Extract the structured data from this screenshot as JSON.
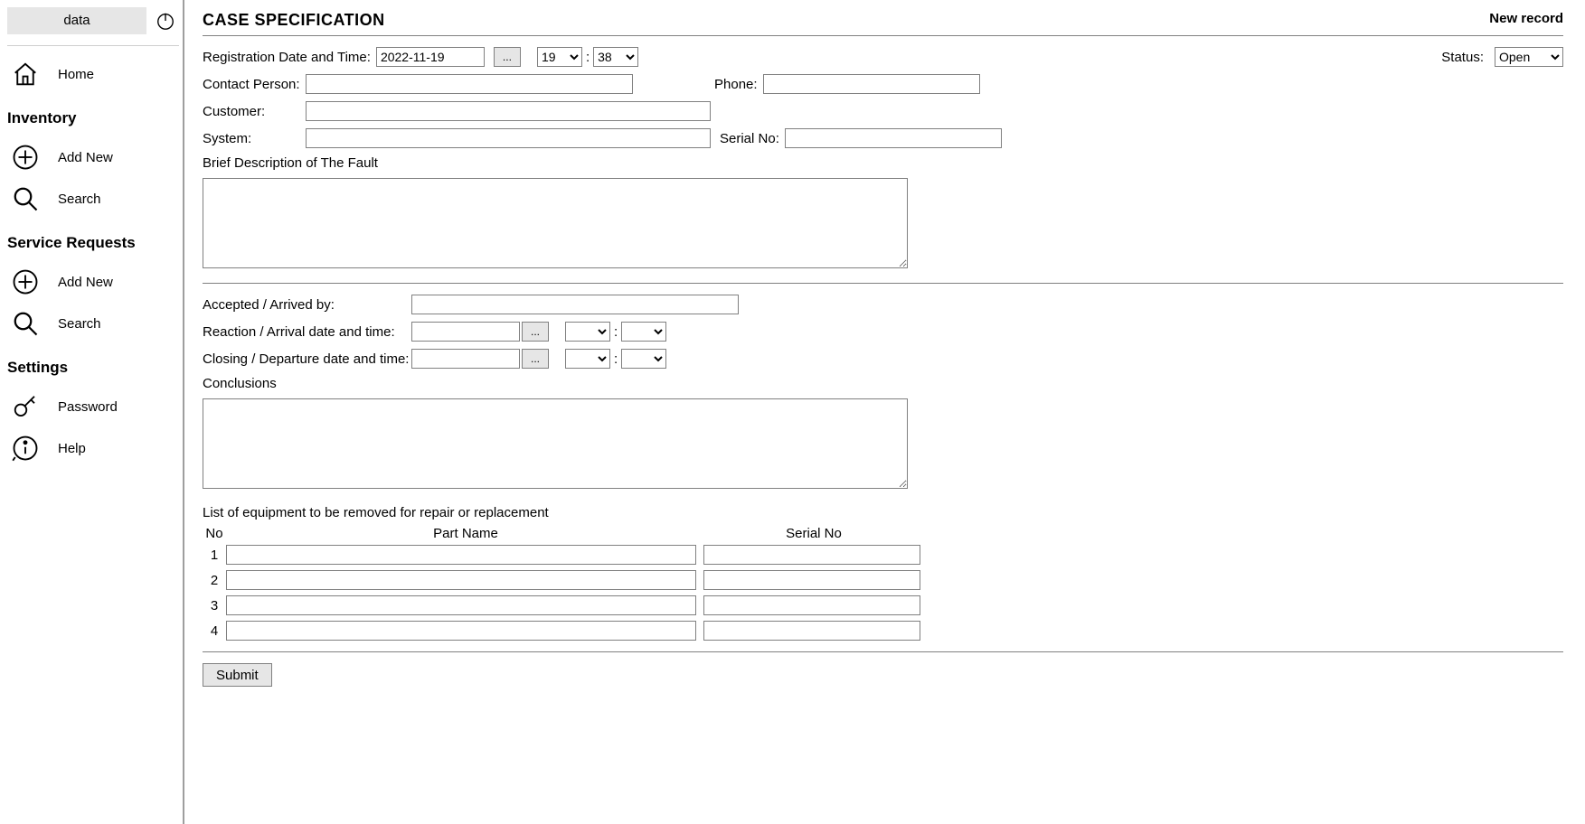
{
  "sidebar": {
    "data_button": "data",
    "home": "Home",
    "sections": {
      "inventory": {
        "title": "Inventory",
        "add": "Add New",
        "search": "Search"
      },
      "service": {
        "title": "Service Requests",
        "add": "Add New",
        "search": "Search"
      },
      "settings": {
        "title": "Settings",
        "password": "Password",
        "help": "Help"
      }
    }
  },
  "header": {
    "title": "CASE SPECIFICATION",
    "new_record": "New record"
  },
  "labels": {
    "reg_datetime": "Registration Date and Time:",
    "status": "Status:",
    "contact": "Contact Person:",
    "phone": "Phone:",
    "customer": "Customer:",
    "system": "System:",
    "serial": "Serial No:",
    "brief": "Brief Description of The Fault",
    "accepted": "Accepted / Arrived by:",
    "reaction": "Reaction / Arrival date and time:",
    "closing": "Closing / Departure date and time:",
    "conclusions": "Conclusions",
    "equip_list": "List of equipment to be removed for repair or replacement",
    "col_no": "No",
    "col_part": "Part Name",
    "col_serial": "Serial No",
    "submit": "Submit",
    "ellipsis": "..."
  },
  "values": {
    "reg_date": "2022-11-19",
    "reg_hour": "19",
    "reg_min": "38",
    "status_selected": "Open",
    "contact": "",
    "phone": "",
    "customer": "",
    "system": "",
    "serial": "",
    "brief": "",
    "accepted_by": "",
    "reaction_date": "",
    "reaction_hour": "",
    "reaction_min": "",
    "closing_date": "",
    "closing_hour": "",
    "closing_min": "",
    "conclusions": ""
  },
  "equipment": [
    {
      "no": "1",
      "part": "",
      "serial": ""
    },
    {
      "no": "2",
      "part": "",
      "serial": ""
    },
    {
      "no": "3",
      "part": "",
      "serial": ""
    },
    {
      "no": "4",
      "part": "",
      "serial": ""
    }
  ]
}
